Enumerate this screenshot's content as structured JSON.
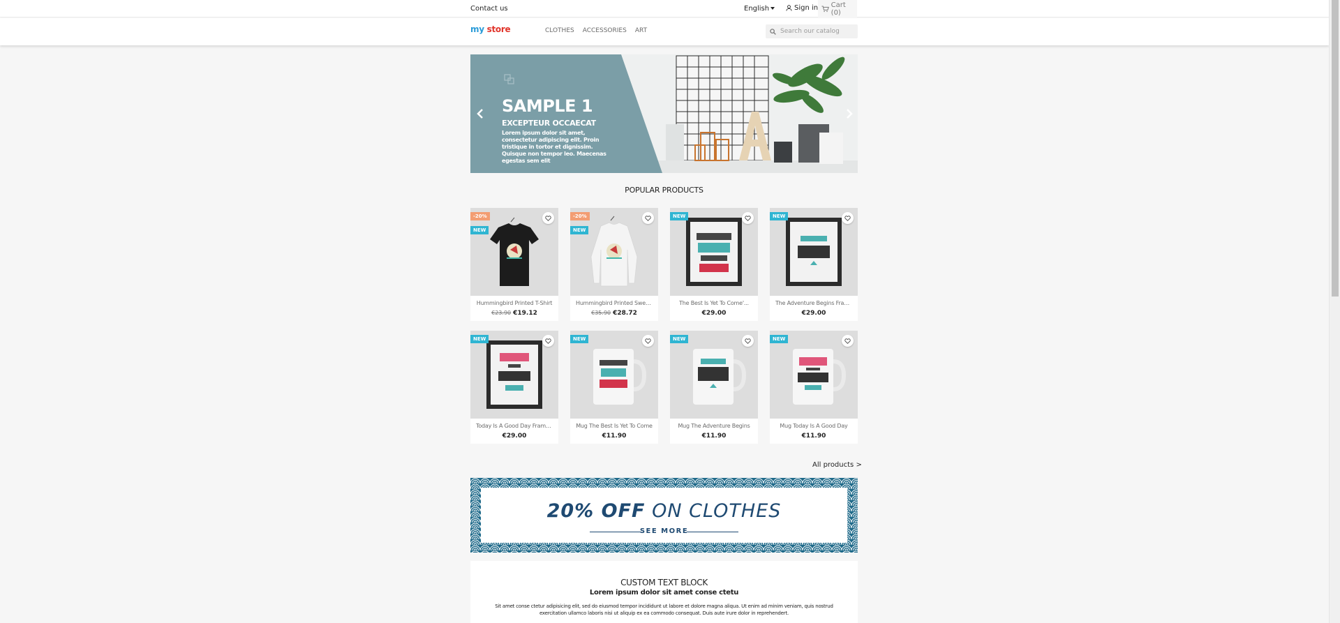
{
  "topbar": {
    "contact": "Contact us",
    "language": "English",
    "signin": "Sign in",
    "cart": "Cart (0)"
  },
  "header": {
    "logo_my": "my",
    "logo_store": "store",
    "nav": [
      "CLOTHES",
      "ACCESSORIES",
      "ART"
    ],
    "search_placeholder": "Search our catalog"
  },
  "slider": {
    "title": "SAMPLE 1",
    "subtitle": "EXCEPTEUR OCCAECAT",
    "description": "Lorem ipsum dolor sit amet, consectetur adipiscing elit. Proin tristique in tortor et dignissim. Quisque non tempor leo. Maecenas egestas sem elit"
  },
  "popular": {
    "title": "POPULAR PRODUCTS",
    "products": [
      {
        "name": "Hummingbird Printed T-Shirt",
        "old_price": "€23.90",
        "price": "€19.12",
        "discount": "-20%",
        "new": "NEW"
      },
      {
        "name": "Hummingbird Printed Sweater",
        "old_price": "€35.90",
        "price": "€28.72",
        "discount": "-20%",
        "new": "NEW"
      },
      {
        "name": "The Best Is Yet To Come'...",
        "price": "€29.00",
        "new": "NEW"
      },
      {
        "name": "The Adventure Begins Framed...",
        "price": "€29.00",
        "new": "NEW"
      },
      {
        "name": "Today Is A Good Day Framed...",
        "price": "€29.00",
        "new": "NEW"
      },
      {
        "name": "Mug The Best Is Yet To Come",
        "price": "€11.90",
        "new": "NEW"
      },
      {
        "name": "Mug The Adventure Begins",
        "price": "€11.90",
        "new": "NEW"
      },
      {
        "name": "Mug Today Is A Good Day",
        "price": "€11.90",
        "new": "NEW"
      }
    ],
    "all_products": "All products"
  },
  "banner": {
    "title_strong": "20% OFF",
    "title_rest": "ON CLOTHES",
    "see_more": "SEE MORE"
  },
  "custom_text": {
    "title": "CUSTOM TEXT BLOCK",
    "subtitle": "Lorem ipsum dolor sit amet conse ctetu",
    "body": "Sit amet conse ctetur adipisicing elit, sed do eiusmod tempor incididunt ut labore et dolore magna aliqua. Ut enim ad minim veniam, quis nostrud exercitation ullamco laboris nisi ut aliquip ex ea commodo consequat. Duis aute irure dolor in reprehendert."
  },
  "colors": {
    "accent": "#2fb5d2",
    "discount": "#f39d72",
    "slider_teal": "#7b9ea7",
    "banner_blue": "#1f4a72"
  }
}
